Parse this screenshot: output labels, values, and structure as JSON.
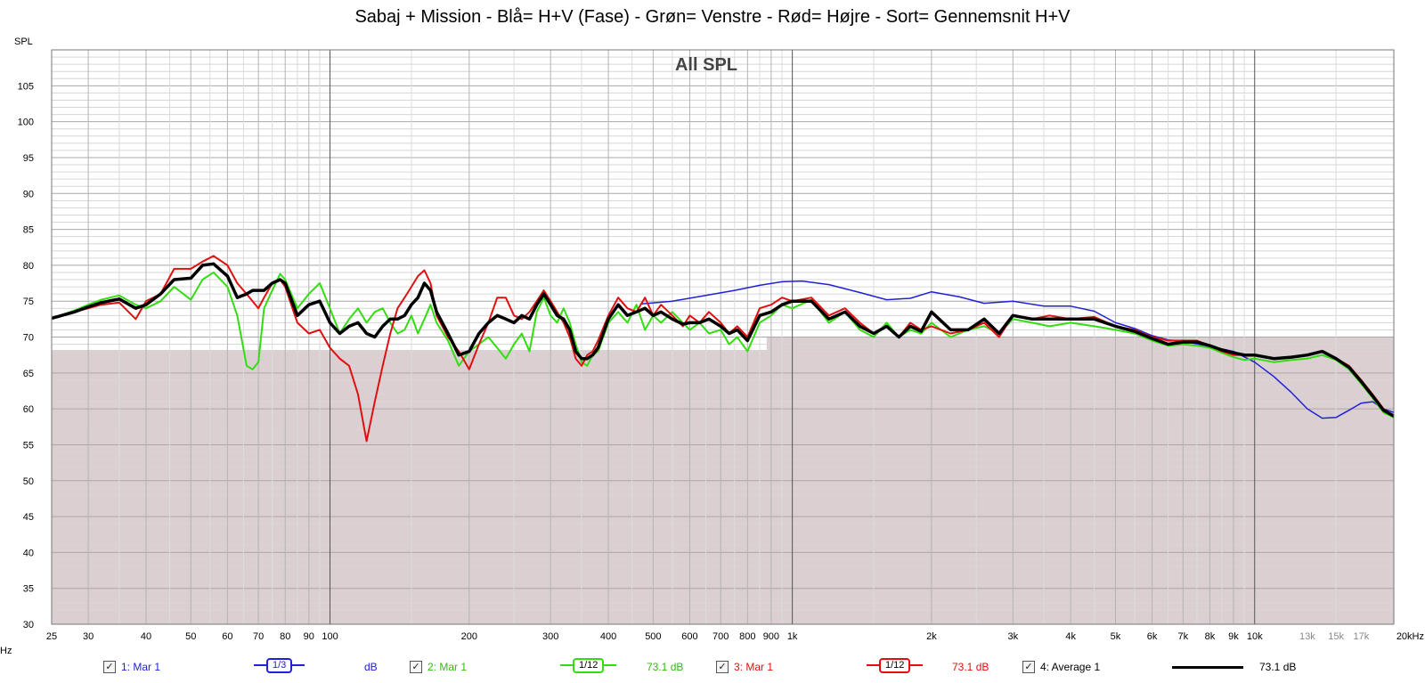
{
  "title": "Sabaj + Mission - Blå= H+V (Fase) - Grøn= Venstre - Rød= Højre - Sort= Gennemsnit H+V",
  "colors": {
    "blue": "#2020d8",
    "green": "#33dd11",
    "red": "#e01010",
    "black": "#000000",
    "plot_bg": "#ffffff",
    "lower_bg": "#dccfd2"
  },
  "legend": [
    {
      "checkbox": "✓",
      "label": "1: Mar 1",
      "smoothing": "1/3",
      "value": "dB",
      "color": "#2020d8"
    },
    {
      "checkbox": "✓",
      "label": "2: Mar 1",
      "smoothing": "1/12",
      "value": "73.1 dB",
      "color": "#33dd11"
    },
    {
      "checkbox": "✓",
      "label": "3: Mar 1",
      "smoothing": "1/12",
      "value": "73.1 dB",
      "color": "#e01010"
    },
    {
      "checkbox": "✓",
      "label": "4: Average 1",
      "smoothing": "",
      "value": "73.1 dB",
      "color": "#000000"
    }
  ],
  "chart_data": {
    "type": "line",
    "title": "Sabaj + Mission - Blå= H+V (Fase) - Grøn= Venstre - Rød= Højre - Sort= Gennemsnit H+V",
    "inner_title": "All SPL",
    "ylabel": "SPL",
    "xlabel": "Hz",
    "x_scale": "log",
    "xlim": [
      25,
      20000
    ],
    "ylim": [
      30,
      110
    ],
    "y_ticks": [
      30,
      35,
      40,
      45,
      50,
      55,
      60,
      65,
      70,
      75,
      80,
      85,
      90,
      95,
      100,
      105
    ],
    "x_ticks": [
      {
        "v": 25,
        "t": "25"
      },
      {
        "v": 30,
        "t": "30"
      },
      {
        "v": 40,
        "t": "40"
      },
      {
        "v": 50,
        "t": "50"
      },
      {
        "v": 60,
        "t": "60"
      },
      {
        "v": 70,
        "t": "70"
      },
      {
        "v": 80,
        "t": "80"
      },
      {
        "v": 90,
        "t": "90"
      },
      {
        "v": 100,
        "t": "100"
      },
      {
        "v": 200,
        "t": "200"
      },
      {
        "v": 300,
        "t": "300"
      },
      {
        "v": 400,
        "t": "400"
      },
      {
        "v": 500,
        "t": "500"
      },
      {
        "v": 600,
        "t": "600"
      },
      {
        "v": 700,
        "t": "700"
      },
      {
        "v": 800,
        "t": "800"
      },
      {
        "v": 900,
        "t": "900"
      },
      {
        "v": 1000,
        "t": "1k"
      },
      {
        "v": 2000,
        "t": "2k"
      },
      {
        "v": 3000,
        "t": "3k"
      },
      {
        "v": 4000,
        "t": "4k"
      },
      {
        "v": 5000,
        "t": "5k"
      },
      {
        "v": 6000,
        "t": "6k"
      },
      {
        "v": 7000,
        "t": "7k"
      },
      {
        "v": 8000,
        "t": "8k"
      },
      {
        "v": 9000,
        "t": "9k"
      },
      {
        "v": 10000,
        "t": "10k"
      },
      {
        "v": 13000,
        "t": "13k"
      },
      {
        "v": 15000,
        "t": "15k"
      },
      {
        "v": 17000,
        "t": "17k"
      },
      {
        "v": 20000,
        "t": "20kHz"
      }
    ],
    "series": [
      {
        "color": "#2020d8",
        "width": 1.5,
        "x": [
          470,
          550,
          650,
          750,
          850,
          950,
          1050,
          1200,
          1400,
          1600,
          1800,
          2000,
          2300,
          2600,
          3000,
          3500,
          4000,
          4500,
          5000,
          5500,
          6000,
          6500,
          7000,
          8000,
          9000,
          10000,
          11000,
          12000,
          13000,
          14000,
          15000,
          16000,
          17000,
          18000,
          19000,
          20000
        ],
        "y": [
          74.6,
          75.0,
          75.8,
          76.5,
          77.2,
          77.7,
          77.8,
          77.3,
          76.2,
          75.2,
          75.4,
          76.3,
          75.6,
          74.7,
          75.0,
          74.3,
          74.3,
          73.6,
          72.0,
          71.2,
          70.2,
          69.6,
          69.4,
          68.7,
          68.0,
          66.5,
          64.5,
          62.3,
          60.0,
          58.7,
          58.8,
          59.8,
          60.8,
          61.0,
          60.0,
          59.5
        ]
      },
      {
        "color": "#33dd11",
        "width": 2,
        "x": [
          25,
          28,
          30,
          32,
          35,
          38,
          40,
          43,
          46,
          50,
          53,
          56,
          60,
          63,
          66,
          68,
          70,
          72,
          75,
          78,
          80,
          85,
          90,
          95,
          100,
          105,
          110,
          115,
          120,
          125,
          130,
          135,
          140,
          145,
          150,
          155,
          160,
          165,
          170,
          180,
          190,
          200,
          210,
          220,
          230,
          240,
          250,
          260,
          270,
          280,
          290,
          300,
          310,
          320,
          330,
          340,
          350,
          360,
          370,
          380,
          400,
          420,
          440,
          460,
          480,
          500,
          520,
          550,
          580,
          600,
          630,
          660,
          700,
          730,
          760,
          800,
          850,
          900,
          950,
          1000,
          1100,
          1200,
          1300,
          1400,
          1500,
          1600,
          1700,
          1800,
          1900,
          2000,
          2200,
          2400,
          2600,
          2800,
          3000,
          3300,
          3600,
          4000,
          4500,
          5000,
          5500,
          6000,
          6500,
          7000,
          7500,
          8000,
          8500,
          9000,
          9500,
          10000,
          11000,
          12000,
          13000,
          14000,
          15000,
          16000,
          17000,
          18000,
          19000,
          20000
        ],
        "y": [
          72.6,
          73.7,
          74.5,
          75.2,
          75.8,
          74.5,
          74.0,
          75.0,
          77.0,
          75.2,
          78.0,
          79.0,
          77.0,
          73.0,
          66.0,
          65.5,
          66.5,
          74.0,
          76.5,
          78.8,
          78.0,
          74.0,
          76.0,
          77.5,
          74.0,
          70.5,
          72.5,
          74.0,
          72.0,
          73.5,
          74.0,
          72.0,
          70.5,
          71.0,
          73.0,
          70.5,
          72.5,
          74.5,
          72.0,
          69.5,
          66.0,
          68.0,
          69.0,
          70.0,
          68.5,
          67.0,
          69.0,
          70.5,
          68.0,
          73.5,
          75.5,
          73.0,
          72.0,
          74.0,
          72.0,
          69.0,
          66.5,
          66.0,
          67.5,
          68.0,
          72.0,
          73.5,
          72.0,
          74.5,
          71.0,
          73.0,
          72.0,
          73.5,
          72.0,
          71.0,
          72.0,
          70.5,
          71.0,
          69.0,
          70.0,
          68.0,
          72.0,
          73.0,
          74.5,
          74.0,
          75.2,
          72.0,
          73.5,
          71.0,
          70.0,
          72.0,
          70.0,
          71.0,
          70.5,
          72.0,
          70.0,
          71.0,
          71.5,
          70.5,
          72.5,
          72.0,
          71.5,
          72.0,
          71.5,
          71.0,
          70.5,
          69.5,
          68.8,
          69.0,
          68.8,
          68.5,
          67.8,
          67.2,
          66.8,
          67.0,
          66.5,
          66.8,
          67.0,
          67.5,
          66.8,
          65.5,
          63.5,
          61.5,
          59.5,
          58.8
        ]
      },
      {
        "color": "#e01010",
        "width": 2,
        "x": [
          25,
          28,
          30,
          32,
          35,
          38,
          40,
          43,
          46,
          50,
          53,
          56,
          60,
          63,
          66,
          68,
          70,
          72,
          75,
          78,
          80,
          85,
          90,
          95,
          100,
          105,
          110,
          115,
          120,
          125,
          130,
          135,
          140,
          145,
          150,
          155,
          160,
          165,
          170,
          180,
          190,
          200,
          210,
          220,
          230,
          240,
          250,
          260,
          270,
          280,
          290,
          300,
          310,
          320,
          330,
          340,
          350,
          360,
          370,
          380,
          400,
          420,
          440,
          460,
          480,
          500,
          520,
          550,
          580,
          600,
          630,
          660,
          700,
          730,
          760,
          800,
          850,
          900,
          950,
          1000,
          1100,
          1200,
          1300,
          1400,
          1500,
          1600,
          1700,
          1800,
          1900,
          2000,
          2200,
          2400,
          2600,
          2800,
          3000,
          3300,
          3600,
          4000,
          4500,
          5000,
          5500,
          6000,
          6500,
          7000,
          7500,
          8000,
          8500,
          9000,
          9500,
          10000,
          11000,
          12000,
          13000,
          14000,
          15000,
          16000,
          17000,
          18000,
          19000,
          20000
        ],
        "y": [
          72.6,
          73.5,
          74.0,
          74.5,
          74.8,
          72.5,
          75.0,
          76.0,
          79.5,
          79.5,
          80.5,
          81.3,
          80.0,
          77.5,
          76.0,
          75.0,
          74.0,
          75.5,
          77.5,
          78.0,
          77.0,
          72.0,
          70.5,
          71.0,
          68.5,
          67.0,
          66.0,
          62.0,
          55.5,
          61.0,
          66.0,
          70.5,
          74.0,
          75.5,
          77.0,
          78.5,
          79.3,
          77.5,
          73.0,
          70.0,
          68.0,
          65.5,
          69.0,
          72.0,
          75.5,
          75.5,
          73.0,
          72.5,
          73.5,
          75.0,
          76.5,
          75.0,
          73.5,
          72.0,
          70.0,
          67.0,
          66.0,
          67.5,
          68.0,
          69.5,
          73.0,
          75.5,
          74.0,
          73.5,
          75.5,
          73.0,
          74.5,
          73.0,
          71.5,
          73.0,
          72.0,
          73.5,
          72.0,
          70.5,
          71.5,
          70.0,
          74.0,
          74.5,
          75.5,
          75.0,
          75.5,
          73.0,
          74.0,
          72.0,
          70.5,
          71.5,
          70.0,
          72.0,
          71.0,
          71.5,
          70.5,
          71.0,
          72.0,
          70.0,
          73.0,
          72.5,
          73.0,
          72.5,
          72.8,
          71.5,
          71.0,
          70.0,
          69.5,
          69.5,
          69.5,
          68.8,
          68.0,
          67.5,
          67.5,
          67.5,
          67.0,
          67.2,
          67.5,
          68.0,
          67.0,
          66.0,
          64.0,
          62.0,
          60.0,
          59.0
        ]
      },
      {
        "color": "#000000",
        "width": 3.5,
        "x": [
          25,
          28,
          30,
          32,
          35,
          38,
          40,
          43,
          46,
          50,
          53,
          56,
          60,
          63,
          66,
          68,
          70,
          72,
          75,
          78,
          80,
          85,
          90,
          95,
          100,
          105,
          110,
          115,
          120,
          125,
          130,
          135,
          140,
          145,
          150,
          155,
          160,
          165,
          170,
          180,
          190,
          200,
          210,
          220,
          230,
          240,
          250,
          260,
          270,
          280,
          290,
          300,
          310,
          320,
          330,
          340,
          350,
          360,
          370,
          380,
          400,
          420,
          440,
          460,
          480,
          500,
          520,
          550,
          580,
          600,
          630,
          660,
          700,
          730,
          760,
          800,
          850,
          900,
          950,
          1000,
          1100,
          1200,
          1300,
          1400,
          1500,
          1600,
          1700,
          1800,
          1900,
          2000,
          2200,
          2400,
          2600,
          2800,
          3000,
          3300,
          3600,
          4000,
          4500,
          5000,
          5500,
          6000,
          6500,
          7000,
          7500,
          8000,
          8500,
          9000,
          9500,
          10000,
          11000,
          12000,
          13000,
          14000,
          15000,
          16000,
          17000,
          18000,
          19000,
          20000
        ],
        "y": [
          72.6,
          73.5,
          74.2,
          74.8,
          75.3,
          74.0,
          74.5,
          76.0,
          78.0,
          78.2,
          80.0,
          80.2,
          78.5,
          75.5,
          76.0,
          76.5,
          76.5,
          76.5,
          77.5,
          78.0,
          77.5,
          73.0,
          74.5,
          75.0,
          72.0,
          70.5,
          71.5,
          72.0,
          70.5,
          70.0,
          71.5,
          72.5,
          72.5,
          73.0,
          74.5,
          75.5,
          77.5,
          76.5,
          73.5,
          70.5,
          67.5,
          68.0,
          70.5,
          72.0,
          73.0,
          72.5,
          72.0,
          73.0,
          72.5,
          74.5,
          76.0,
          74.5,
          73.0,
          72.5,
          71.0,
          68.0,
          67.0,
          67.0,
          67.5,
          68.5,
          72.5,
          74.5,
          73.0,
          73.5,
          74.0,
          73.0,
          73.5,
          72.5,
          71.8,
          72.0,
          72.0,
          72.5,
          71.5,
          70.5,
          71.0,
          69.5,
          73.0,
          73.5,
          74.5,
          75.0,
          75.0,
          72.5,
          73.5,
          71.5,
          70.5,
          71.5,
          70.0,
          71.5,
          70.8,
          73.5,
          71.0,
          71.0,
          72.5,
          70.5,
          73.0,
          72.5,
          72.5,
          72.5,
          72.5,
          71.5,
          70.8,
          69.8,
          69.0,
          69.3,
          69.3,
          68.8,
          68.2,
          67.8,
          67.5,
          67.5,
          67.0,
          67.2,
          67.5,
          68.0,
          67.0,
          65.8,
          63.8,
          61.8,
          59.8,
          59.0
        ]
      }
    ]
  }
}
